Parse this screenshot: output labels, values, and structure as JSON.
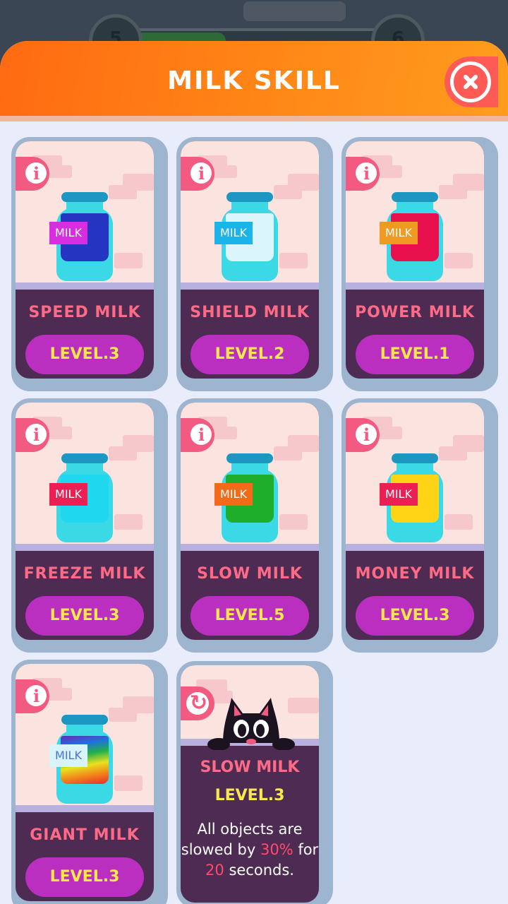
{
  "background_hud": {
    "left_level": "5",
    "right_level": "6"
  },
  "header": {
    "title": "MILK SKILL"
  },
  "cards": [
    {
      "name": "SPEED MILK",
      "level": "LEVEL.3",
      "label": "MILK",
      "liquid_color": "#2634c2",
      "label_color": "#d62ee0"
    },
    {
      "name": "SHIELD MILK",
      "level": "LEVEL.2",
      "label": "MILK",
      "liquid_color": "#dbf6fb",
      "label_color": "#1ab4ea"
    },
    {
      "name": "POWER MILK",
      "level": "LEVEL.1",
      "label": "MILK",
      "liquid_color": "#e8114e",
      "label_color": "#f09a23"
    },
    {
      "name": "FREEZE MILK",
      "level": "LEVEL.3",
      "label": "MILK",
      "liquid_color": "#1fd7ee",
      "label_color": "#ec1f55"
    },
    {
      "name": "SLOW MILK",
      "level": "LEVEL.5",
      "label": "MILK",
      "liquid_color": "#1fae2c",
      "label_color": "#f46a18"
    },
    {
      "name": "MONEY MILK",
      "level": "LEVEL.3",
      "label": "MILK",
      "liquid_color": "#ffd416",
      "label_color": "#ec1f55"
    },
    {
      "name": "GIANT MILK",
      "level": "LEVEL.3",
      "label": "MILK",
      "liquid_color": "rainbow",
      "label_color": "#d6f4fa"
    }
  ],
  "detail": {
    "name": "SLOW MILK",
    "level": "LEVEL.3",
    "desc_part1": "All objects are slowed by ",
    "desc_pct": "30%",
    "desc_part2": " for ",
    "desc_secs": "20",
    "desc_part3": " seconds."
  }
}
